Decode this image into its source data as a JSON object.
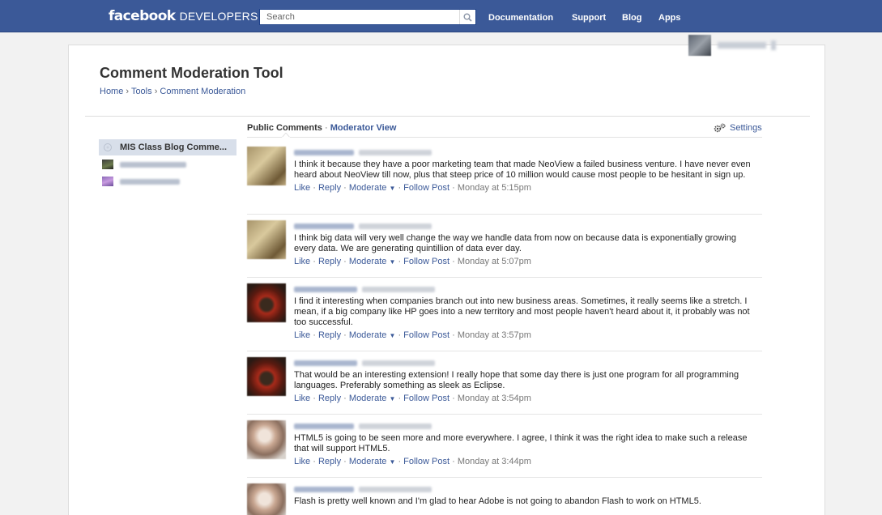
{
  "topbar": {
    "logo_bold": "facebook",
    "logo_light": "DEVELOPERS",
    "search_placeholder": "Search",
    "nav": [
      "Documentation",
      "Support",
      "Blog",
      "Apps"
    ]
  },
  "page": {
    "title": "Comment Moderation Tool",
    "breadcrumb": [
      "Home",
      "Tools",
      "Comment Moderation"
    ],
    "breadcrumb_sep": "›"
  },
  "sidebar": {
    "items": [
      {
        "label": "MIS Class Blog Comme...",
        "selected": true,
        "icon": "comment-icon"
      },
      {
        "label": "",
        "selected": false,
        "icon": "site-icon"
      },
      {
        "label": "",
        "selected": false,
        "icon": "site-icon"
      }
    ]
  },
  "tabs": {
    "public": "Public Comments",
    "sep": "·",
    "moderator": "Moderator View",
    "settings": "Settings"
  },
  "actions": {
    "like": "Like",
    "reply": "Reply",
    "moderate": "Moderate",
    "follow": "Follow Post",
    "sep": "·",
    "arrow": "▼"
  },
  "comments": [
    {
      "text": "I think it because they have a poor marketing team that made NeoView a failed business venture. I have never even heard about NeoView till now, plus that steep price of 10 million would cause most people to be hesitant in sign up.",
      "time": "Monday at 5:15pm"
    },
    {
      "text": "I think big data will very well change the way we handle data from now on because data is exponentially growing every data. We are generating quintillion of data ever day.",
      "time": "Monday at 5:07pm"
    },
    {
      "text": "I find it interesting when companies branch out into new business areas. Sometimes, it really seems like a stretch. I mean, if a big company like HP goes into a new territory and most people haven't heard about it, it probably was not too successful.",
      "time": "Monday at 3:57pm"
    },
    {
      "text": "That would be an interesting extension! I really hope that some day there is just one program for all programming languages. Preferably something as sleek as Eclipse.",
      "time": "Monday at 3:54pm"
    },
    {
      "text": "HTML5 is going to be seen more and more everywhere. I agree, I think it was the right idea to make such a release that will support HTML5.",
      "time": "Monday at 3:44pm"
    },
    {
      "text": "Flash is pretty well known and I'm glad to hear Adobe is not going to abandon Flash to work on HTML5.",
      "time": ""
    }
  ],
  "colors": {
    "brand": "#3b5998",
    "link": "#3b5998",
    "selected_bg": "#d8dfea"
  }
}
